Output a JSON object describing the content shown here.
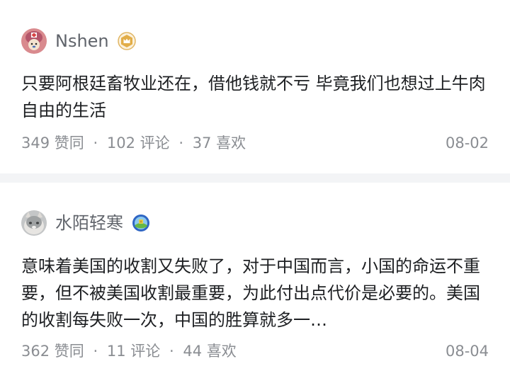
{
  "comments": [
    {
      "author": "Nshen",
      "badge_icon": "crown-badge-icon",
      "text": "只要阿根廷畜牧业还在，借他钱就不亏 毕竟我们也想过上牛肉自由的生活",
      "likes": "349",
      "likes_label": "赞同",
      "comments": "102",
      "comments_label": "评论",
      "favorites": "37",
      "favorites_label": "喜欢",
      "date": "08-02",
      "separator": "·"
    },
    {
      "author": "水陌轻寒",
      "badge_icon": "level-badge-icon",
      "text": "意味着美国的收割又失败了，对于中国而言，小国的命运不重要，但不被美国收割最重要，为此付出点代价是必要的。美国的收割每失败一次，中国的胜算就多一…",
      "likes": "362",
      "likes_label": "赞同",
      "comments": "11",
      "comments_label": "评论",
      "favorites": "44",
      "favorites_label": "喜欢",
      "date": "08-04",
      "separator": "·"
    }
  ],
  "colors": {
    "background": "#f3f4f6",
    "card": "#ffffff",
    "text_primary": "#1d1f22",
    "text_secondary": "#8a8d92",
    "badge_gold": "#d7a540"
  }
}
